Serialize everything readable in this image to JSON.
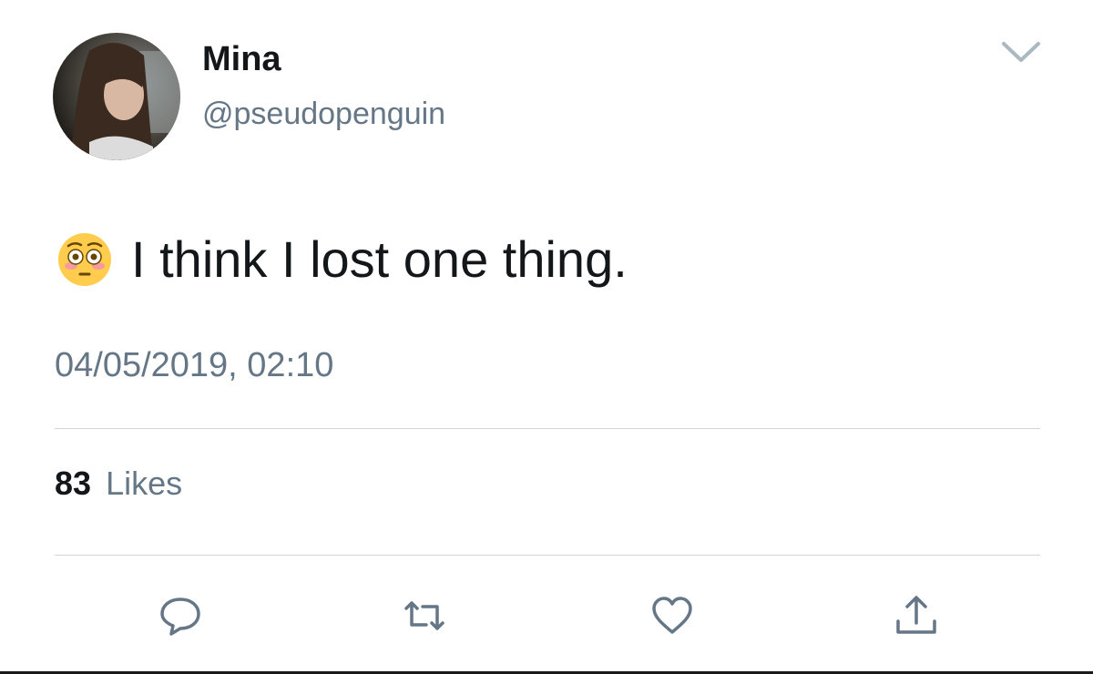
{
  "tweet": {
    "display_name": "Mina",
    "handle": "@pseudopenguin",
    "text": "I think I lost one thing.",
    "emoji": "flushed-face-emoji",
    "timestamp": "04/05/2019, 02:10"
  },
  "stats": {
    "likes_count": "83",
    "likes_label": "Likes"
  },
  "actions": {
    "reply_icon": "speech-bubble-icon",
    "retweet_icon": "retweet-arrows-icon",
    "like_icon": "heart-icon",
    "share_icon": "share-upload-icon"
  },
  "colors": {
    "text_primary": "#14171a",
    "text_secondary": "#657786",
    "divider": "#ccd6dd"
  }
}
